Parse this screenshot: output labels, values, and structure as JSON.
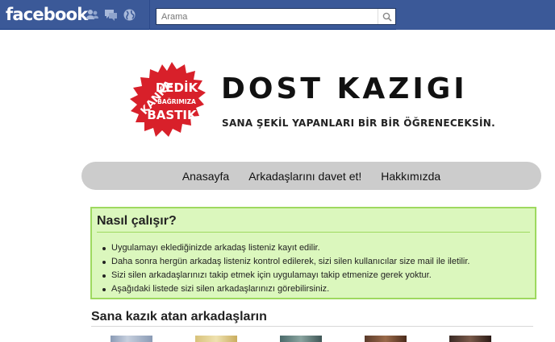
{
  "fb_bar": {
    "logo": "facebook",
    "icons": [
      "friends-icon",
      "messages-icon",
      "notifications-globe-icon"
    ],
    "search": {
      "placeholder": "Arama",
      "icon": "search-icon"
    }
  },
  "app": {
    "badge": {
      "line1": "KANKA",
      "line2": "DEDİK",
      "line3": "BAĞRIMIZA",
      "line4": "BASTIK"
    },
    "title": "DOST KAZIGI",
    "subtitle": "SANA ŞEKİL YAPANLARI BİR BİR ÖĞRENECEKSİN."
  },
  "nav": {
    "items": [
      "Anasayfa",
      "Arkadaşlarını davet et!",
      "Hakkımızda"
    ]
  },
  "howto": {
    "title": "Nasıl çalışır?",
    "items": [
      "Uygulamayı eklediğinizde arkadaş listeniz kayıt edilir.",
      "Daha sonra hergün arkadaş listeniz kontrol edilerek, sizi silen kullanıcılar size mail ile iletilir.",
      "Sizi silen arkadaşlarınızı takip etmek için uygulamayı takip etmenize gerek yoktur.",
      "Aşağıdaki listede sizi silen arkadaşlarınızı görebilirsiniz."
    ]
  },
  "friends": {
    "title": "Sana kazık atan arkadaşların",
    "thumb_colors": [
      "#8a9bb5",
      "#d8c27a",
      "#4a6a6a",
      "#5a3a2a",
      "#3a2a25"
    ]
  },
  "colors": {
    "fb_blue": "#3b5998",
    "badge_red": "#d8202a",
    "howto_bg": "#dbf7bd",
    "howto_border": "#9ed95f"
  }
}
